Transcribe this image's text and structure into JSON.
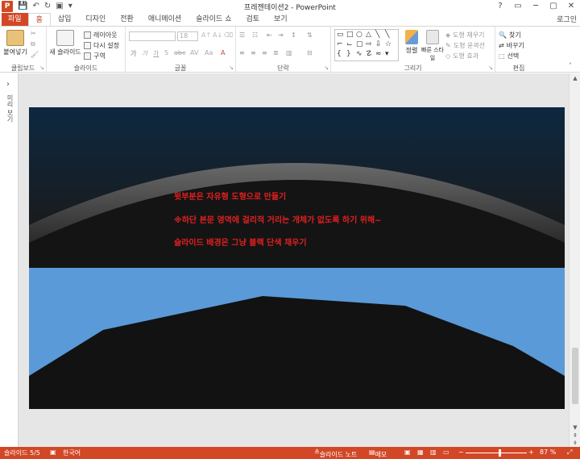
{
  "app": {
    "title": "프레젠테이션2 - PowerPoint",
    "logo_letter": "P",
    "login_label": "로그인",
    "window_controls": [
      "?",
      "▭",
      "─",
      "▢",
      "✕"
    ]
  },
  "qat_icons": [
    "save-icon",
    "undo-icon",
    "redo-icon",
    "customize-icon"
  ],
  "tabs": [
    {
      "label": "파일"
    },
    {
      "label": "홈"
    },
    {
      "label": "삽입"
    },
    {
      "label": "디자인"
    },
    {
      "label": "전환"
    },
    {
      "label": "애니메이션"
    },
    {
      "label": "슬라이드 쇼"
    },
    {
      "label": "검토"
    },
    {
      "label": "보기"
    }
  ],
  "ribbon": {
    "clipboard": {
      "label": "클립보드",
      "paste": "붙여넣기"
    },
    "slides": {
      "label": "슬라이드",
      "new_slide": "새 슬라이드",
      "layout": "레이아웃",
      "reset": "다시 설정",
      "section": "구역"
    },
    "font": {
      "label": "글꼴",
      "font_size": "18",
      "aa_label": "Aa",
      "bold": "가",
      "italic": "가",
      "underline": "가",
      "shadow": "S",
      "strike": "abc",
      "spacing": "AV"
    },
    "paragraph": {
      "label": "단락"
    },
    "drawing": {
      "label": "그리기",
      "arrange": "정렬",
      "quick_styles": "빠른 스타일",
      "fill": "도형 채우기",
      "outline": "도형 윤곽선",
      "effects": "도형 효과"
    },
    "editing": {
      "label": "편집",
      "find": "찾기",
      "replace": "바꾸기",
      "select": "선택"
    }
  },
  "leftpane": {
    "label": "미리 보기"
  },
  "slide": {
    "notes": [
      "윗부분은 자유형 도형으로 만들기",
      "※하단 본문 영역에 걸리적 거리는 개체가 없도록 하기 위해~",
      "슬라이드 배경은 그냥 블랙 단색 채우기"
    ],
    "colors": {
      "background": "#121212",
      "top_gradient_start": "#0d2840",
      "band": "#5a9ad8",
      "note_text": "#e02020",
      "accent": "#d24726"
    }
  },
  "status": {
    "slide_indicator": "슬라이드 5/5",
    "language": "한국어",
    "notes_button": "슬라이드 노트",
    "comments_button": "메모",
    "zoom": "87 %",
    "zoom_level": 0.55
  }
}
